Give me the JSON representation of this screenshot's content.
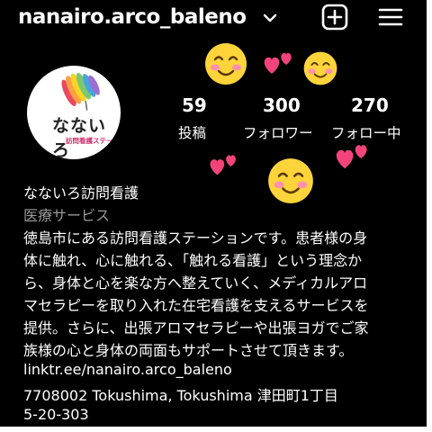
{
  "profile": {
    "username": "nanairo.arco_baleno",
    "name": "なないろ訪問看護",
    "category": "医療サービス",
    "bio_lines": [
      "徳島市にある訪問看護ステーションです。患者様の身",
      "体に触れ、心に触れる、「触れる看護」という理念か",
      "ら、身体と心を楽な方へ整えていく、メディカルアロ",
      "マセラピーを取り入れた在宅看護を支えるサービスを",
      "提供。さらに、出張アロマセラピーや出張ヨガでご家",
      "族様の心と身体の両面もサポートさせて頂きます。"
    ],
    "link": "linktr.ee/nanairo.arco_baleno",
    "address_line1": "7708002 Tokushima, Tokushima 津田町1丁目",
    "address_line2": "5-20-303"
  },
  "logo": {
    "text": "なないろ",
    "sub": "訪問看護ステーション"
  },
  "stats": {
    "posts": {
      "value": "59",
      "label": "投稿"
    },
    "followers": {
      "value": "300",
      "label": "フォロワー"
    },
    "following": {
      "value": "270",
      "label": "フォロー中"
    }
  },
  "icons": {
    "dropdown": "chevron-down-icon",
    "new_post": "plus-square-icon",
    "menu": "hamburger-menu-icon"
  },
  "colors": {
    "background": "#000000",
    "text": "#ffffff",
    "muted": "#9a9a9a",
    "heart": "#f2447a",
    "emoji": "#ffd43b",
    "blush": "#ff8fae"
  }
}
